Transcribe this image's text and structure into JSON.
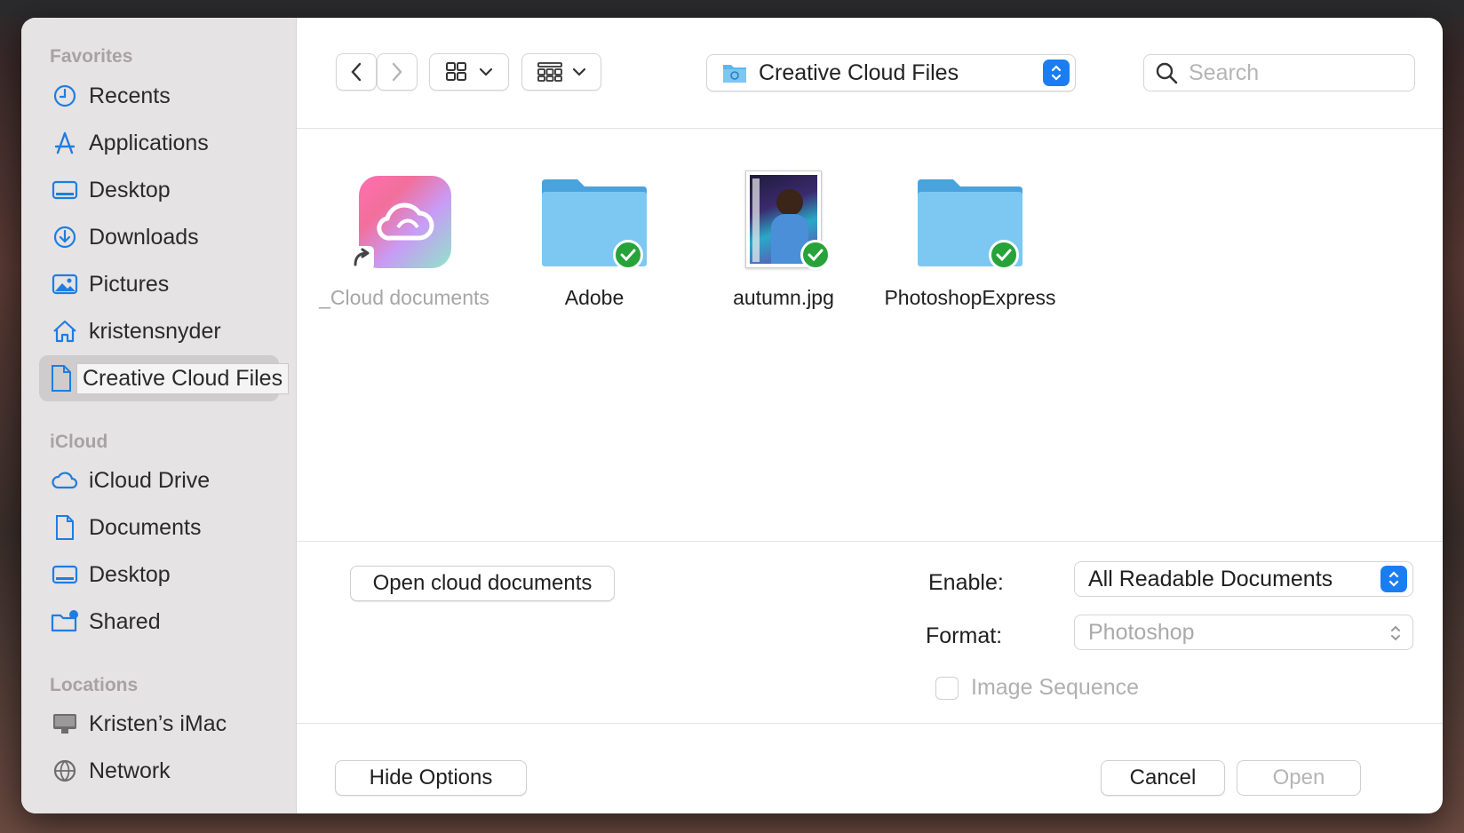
{
  "sidebar": {
    "sections": [
      {
        "title": "Favorites"
      },
      {
        "title": "iCloud"
      },
      {
        "title": "Locations"
      }
    ],
    "favorites": [
      {
        "label": "Recents",
        "icon": "clock-icon"
      },
      {
        "label": "Applications",
        "icon": "applications-icon"
      },
      {
        "label": "Desktop",
        "icon": "desktop-icon"
      },
      {
        "label": "Downloads",
        "icon": "download-icon"
      },
      {
        "label": "Pictures",
        "icon": "pictures-icon"
      },
      {
        "label": "kristensnyder",
        "icon": "home-icon"
      },
      {
        "label": "Creative Cloud Files",
        "icon": "document-icon",
        "selected": true
      }
    ],
    "icloud": [
      {
        "label": "iCloud Drive",
        "icon": "cloud-icon"
      },
      {
        "label": "Documents",
        "icon": "document-icon"
      },
      {
        "label": "Desktop",
        "icon": "desktop-icon"
      },
      {
        "label": "Shared",
        "icon": "shared-folder-icon"
      }
    ],
    "locations": [
      {
        "label": "Kristen’s iMac",
        "icon": "imac-icon"
      },
      {
        "label": "Network",
        "icon": "network-icon"
      }
    ]
  },
  "toolbar": {
    "path_label": "Creative Cloud Files",
    "search_placeholder": "Search"
  },
  "files": [
    {
      "name": "_Cloud documents",
      "kind": "app-alias",
      "synced": false
    },
    {
      "name": "Adobe",
      "kind": "folder",
      "synced": true
    },
    {
      "name": "autumn.jpg",
      "kind": "image",
      "synced": true
    },
    {
      "name": "PhotoshopExpress",
      "kind": "folder",
      "synced": true
    }
  ],
  "options": {
    "open_cloud_label": "Open cloud documents",
    "enable_label": "Enable:",
    "enable_value": "All Readable Documents",
    "format_label": "Format:",
    "format_value": "Photoshop",
    "image_sequence_label": "Image Sequence"
  },
  "footer": {
    "hide_options_label": "Hide Options",
    "cancel_label": "Cancel",
    "open_label": "Open"
  },
  "colors": {
    "accent": "#1a7ef2",
    "sync_check": "#27a33a",
    "folder": "#5cb6ec"
  }
}
